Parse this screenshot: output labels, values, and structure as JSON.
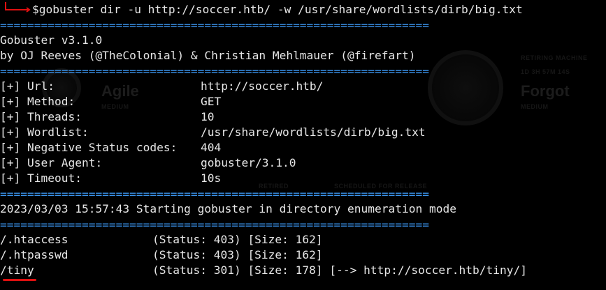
{
  "command": {
    "prompt_symbol": "$",
    "text": "gobuster dir -u http://soccer.htb/ -w /usr/share/wordlists/dirb/big.txt"
  },
  "separator": "===============================================================",
  "banner": {
    "version": "Gobuster v3.1.0",
    "authors": "by OJ Reeves (@TheColonial) & Christian Mehlmauer (@firefart)"
  },
  "config": [
    {
      "key": "[+] Url:",
      "value": "http://soccer.htb/"
    },
    {
      "key": "[+] Method:",
      "value": "GET"
    },
    {
      "key": "[+] Threads:",
      "value": "10"
    },
    {
      "key": "[+] Wordlist:",
      "value": "/usr/share/wordlists/dirb/big.txt"
    },
    {
      "key": "[+] Negative Status codes:",
      "value": "404"
    },
    {
      "key": "[+] User Agent:",
      "value": "gobuster/3.1.0"
    },
    {
      "key": "[+] Timeout:",
      "value": "10s"
    }
  ],
  "start_message": "2023/03/03 15:57:43 Starting gobuster in directory enumeration mode",
  "results": [
    {
      "path": "/.htaccess",
      "status": "(Status: 403) [Size: 162]"
    },
    {
      "path": "/.htpasswd",
      "status": "(Status: 403) [Size: 162]"
    },
    {
      "path": "/tiny",
      "status": "(Status: 301) [Size: 178] [--> http://soccer.htb/tiny/]"
    }
  ],
  "background": {
    "left_machine": {
      "name": "Agile",
      "difficulty": "MEDIUM"
    },
    "right_machine": {
      "name": "Forgot",
      "difficulty": "MEDIUM",
      "label1": "RETIRING MACHINE",
      "label2": "1D 3H 57M 14S"
    },
    "footer_labels": [
      "RETIRED",
      "SCHEDULED FOR RELEASE"
    ]
  },
  "colors": {
    "accent": "#3a93ec",
    "underline": "#e01010",
    "background": "#000000"
  }
}
